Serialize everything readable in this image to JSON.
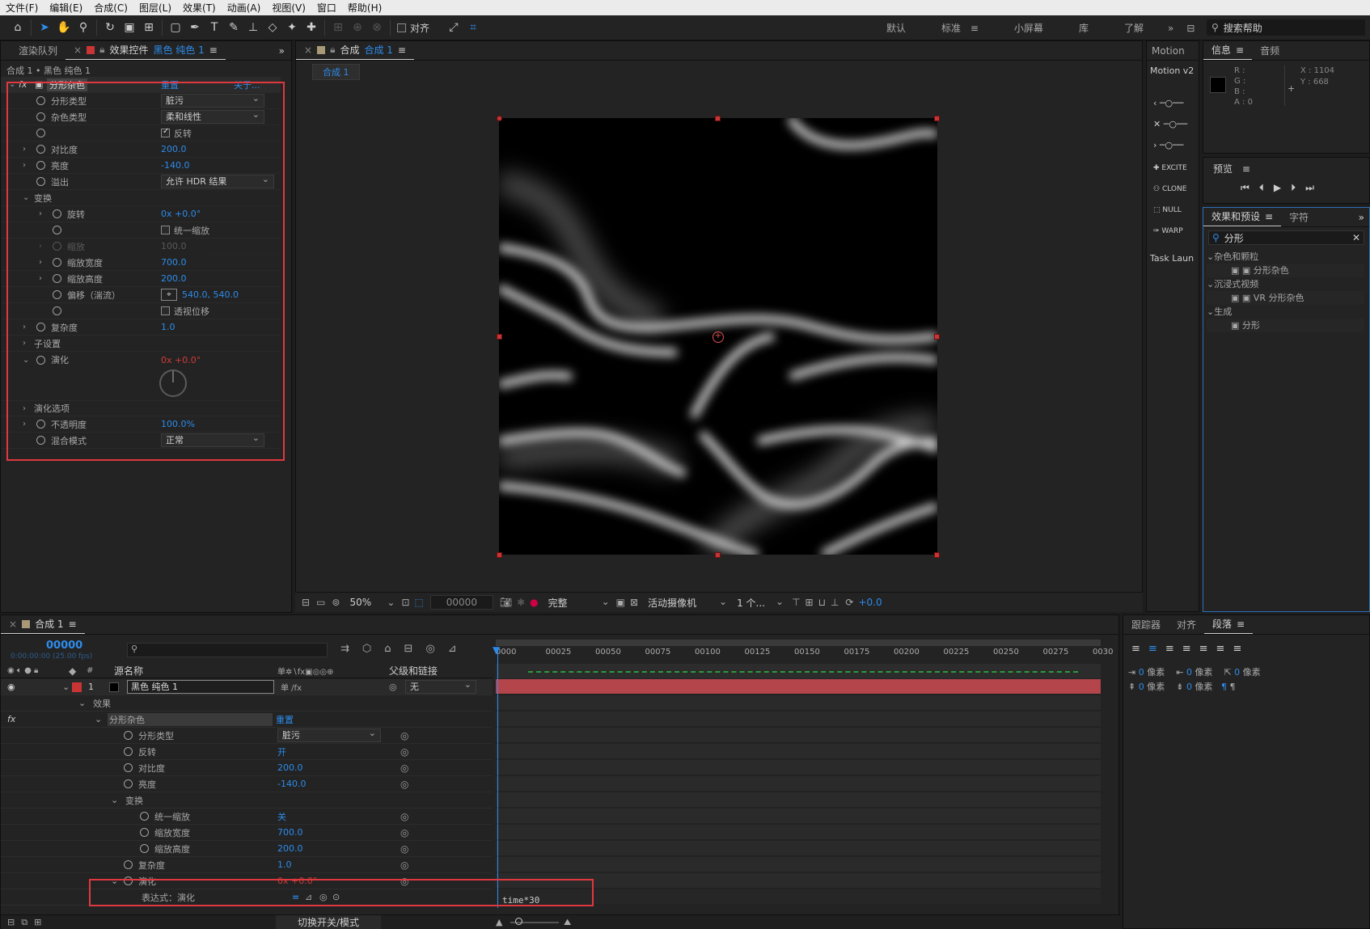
{
  "menu": [
    "文件(F)",
    "编辑(E)",
    "合成(C)",
    "图层(L)",
    "效果(T)",
    "动画(A)",
    "视图(V)",
    "窗口",
    "帮助(H)"
  ],
  "toolbar": {
    "align_label": "对齐"
  },
  "workspaces": [
    "默认",
    "标准",
    "小屏幕",
    "库",
    "了解"
  ],
  "search_help": "搜索帮助",
  "effect_controls": {
    "tabs": [
      "渲染队列",
      "效果控件"
    ],
    "layer_name": "黑色 纯色 1",
    "breadcrumb": "合成 1 • 黑色 纯色 1",
    "effect_name": "分形杂色",
    "reset": "重置",
    "about": "关于...",
    "rows": [
      {
        "label": "分形类型",
        "dropdown": "脏污"
      },
      {
        "label": "杂色类型",
        "dropdown": "柔和线性"
      },
      {
        "label": "",
        "checkbox": "反转",
        "checked": true
      },
      {
        "label": "对比度",
        "value": "200.0"
      },
      {
        "label": "亮度",
        "value": "-140.0"
      },
      {
        "label": "溢出",
        "dropdown": "允许 HDR 结果"
      },
      {
        "label": "变换"
      },
      {
        "label": "旋转",
        "value": "0x +0.0°"
      },
      {
        "label": "",
        "checkbox": "统一缩放",
        "checked": false
      },
      {
        "label": "缩放",
        "value": "100.0"
      },
      {
        "label": "缩放宽度",
        "value": "700.0"
      },
      {
        "label": "缩放高度",
        "value": "200.0"
      },
      {
        "label": "偏移（湍流）",
        "value": "540.0, 540.0"
      },
      {
        "label": "",
        "checkbox": "透视位移",
        "checked": false
      },
      {
        "label": "复杂度",
        "value": "1.0"
      },
      {
        "label": "子设置"
      },
      {
        "label": "演化",
        "value": "0x +0.0°"
      },
      {
        "label": "演化选项"
      },
      {
        "label": "不透明度",
        "value": "100.0%"
      },
      {
        "label": "混合模式",
        "dropdown": "正常"
      }
    ]
  },
  "comp": {
    "tab_prefix": "合成",
    "tab_name": "合成 1",
    "flow_tab": "合成 1",
    "zoom": "50%",
    "timecode": "00000",
    "resolution": "完整",
    "camera": "活动摄像机",
    "views": "1 个...",
    "exposure": "+0.0"
  },
  "motion": {
    "tabs": [
      "Motion",
      "Motion v2"
    ],
    "buttons": [
      "EXCITE",
      "CLONE",
      "NULL",
      "WARP"
    ],
    "task": "Task Laun"
  },
  "info": {
    "tabs": [
      "信息",
      "音频"
    ],
    "r": "R :",
    "g": "G :",
    "b": "B :",
    "a": "A : 0",
    "x": "X : 1104",
    "y": "Y : 668"
  },
  "preview": {
    "title": "预览"
  },
  "effects_presets": {
    "tabs": [
      "效果和预设",
      "字符"
    ],
    "search": "分形",
    "tree": [
      {
        "group": "杂色和颗粒",
        "items": [
          "分形杂色"
        ]
      },
      {
        "group": "沉浸式视频",
        "items": [
          "VR 分形杂色"
        ]
      },
      {
        "group": "生成",
        "items": [
          "分形"
        ]
      }
    ]
  },
  "timeline": {
    "tab": "合成 1",
    "timecode": "00000",
    "timecode_sub": "0:00:00:00 (25.00 fps)",
    "col_source": "源名称",
    "col_parent": "父级和链接",
    "ruler": [
      "0000",
      "00025",
      "00050",
      "00075",
      "00100",
      "00125",
      "00150",
      "00175",
      "00200",
      "00225",
      "00250",
      "00275",
      "0030"
    ],
    "layer": {
      "num": "1",
      "name": "黑色 纯色 1",
      "parent": "无"
    },
    "rows": [
      {
        "label": "效果"
      },
      {
        "label": "分形杂色",
        "value": "重置"
      },
      {
        "label": "分形类型",
        "dropdown": "脏污"
      },
      {
        "label": "反转",
        "value": "开"
      },
      {
        "label": "对比度",
        "value": "200.0"
      },
      {
        "label": "亮度",
        "value": "-140.0"
      },
      {
        "label": "变换"
      },
      {
        "label": "统一缩放",
        "value": "关"
      },
      {
        "label": "缩放宽度",
        "value": "700.0"
      },
      {
        "label": "缩放高度",
        "value": "200.0"
      },
      {
        "label": "复杂度",
        "value": "1.0"
      },
      {
        "label": "演化",
        "value": "0x +0.0°"
      },
      {
        "label": "表达式：演化"
      }
    ],
    "expression": "time*30",
    "toggle_label": "切换开关/模式"
  },
  "paragraph": {
    "tabs": [
      "跟踪器",
      "对齐",
      "段落"
    ],
    "unit": "像素",
    "zero": "0"
  }
}
